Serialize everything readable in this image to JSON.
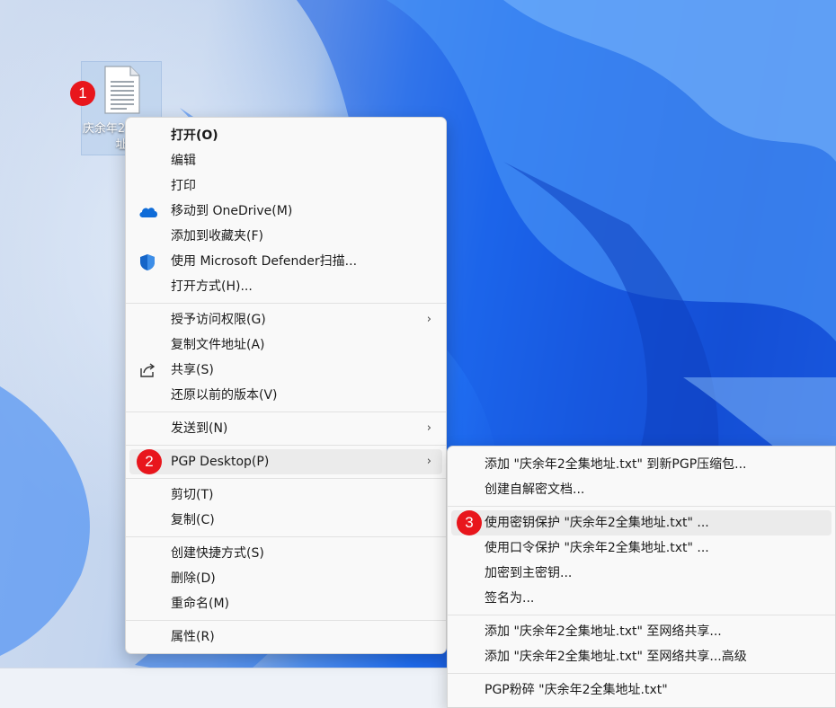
{
  "desktop": {
    "file_label": "庆余年2全集地址"
  },
  "badges": [
    "1",
    "2",
    "3"
  ],
  "context_menu": {
    "groups": [
      [
        {
          "label": "打开(O)",
          "bold": true
        },
        {
          "label": "编辑"
        },
        {
          "label": "打印"
        },
        {
          "label": "移动到 OneDrive(M)",
          "icon": "onedrive-cloud-icon"
        },
        {
          "label": "添加到收藏夹(F)"
        },
        {
          "label": "使用 Microsoft Defender扫描...",
          "icon": "defender-shield-icon"
        },
        {
          "label": "打开方式(H)..."
        }
      ],
      [
        {
          "label": "授予访问权限(G)",
          "submenu": true
        },
        {
          "label": "复制文件地址(A)"
        },
        {
          "label": "共享(S)",
          "icon": "share-icon"
        },
        {
          "label": "还原以前的版本(V)"
        }
      ],
      [
        {
          "label": "发送到(N)",
          "submenu": true
        }
      ],
      [
        {
          "label": "PGP Desktop(P)",
          "submenu": true,
          "hover": true
        }
      ],
      [
        {
          "label": "剪切(T)"
        },
        {
          "label": "复制(C)"
        }
      ],
      [
        {
          "label": "创建快捷方式(S)"
        },
        {
          "label": "删除(D)"
        },
        {
          "label": "重命名(M)"
        }
      ],
      [
        {
          "label": "属性(R)"
        }
      ]
    ]
  },
  "pgp_submenu": {
    "groups": [
      [
        {
          "label": "添加 \"庆余年2全集地址.txt\" 到新PGP压缩包..."
        },
        {
          "label": "创建自解密文档..."
        }
      ],
      [
        {
          "label": "使用密钥保护 \"庆余年2全集地址.txt\" ...",
          "hover": true
        },
        {
          "label": "使用口令保护 \"庆余年2全集地址.txt\" ..."
        },
        {
          "label": "加密到主密钥..."
        },
        {
          "label": "签名为..."
        }
      ],
      [
        {
          "label": "添加 \"庆余年2全集地址.txt\" 至网络共享..."
        },
        {
          "label": "添加 \"庆余年2全集地址.txt\" 至网络共享...高级"
        }
      ],
      [
        {
          "label": "PGP粉碎 \"庆余年2全集地址.txt\""
        }
      ]
    ]
  },
  "colors": {
    "badge": "#e8161c",
    "menu_bg": "#f9f9f9",
    "hover_bg": "#ebebeb",
    "onedrive": "#0f6cd8",
    "defender": "#1565c8"
  }
}
